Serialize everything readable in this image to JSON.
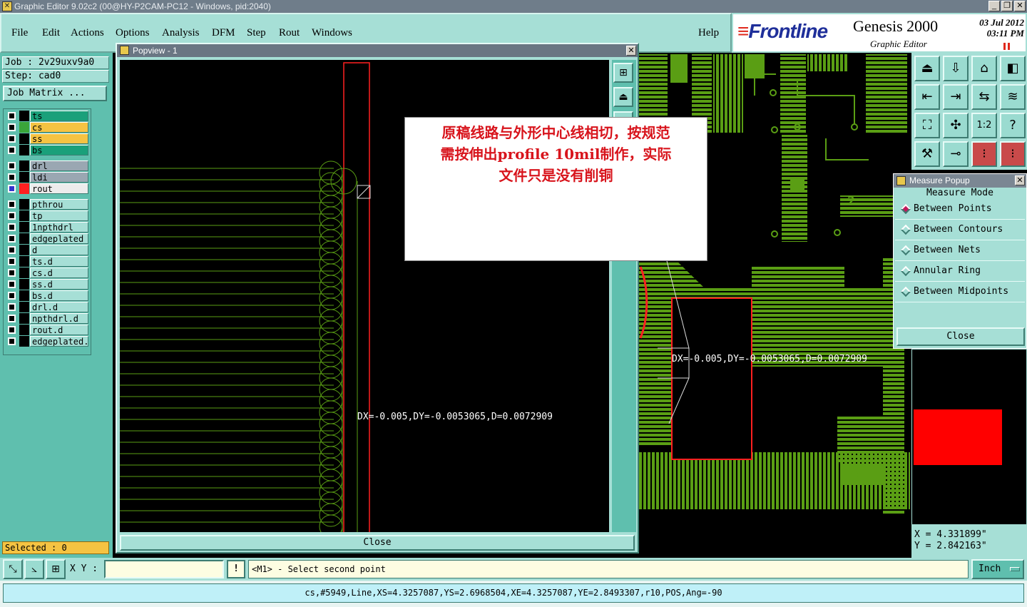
{
  "window": {
    "title": "Graphic Editor 9.02c2 (00@HY-P2CAM-PC12 - Windows, pid:2040)",
    "controls": [
      "_",
      "❐",
      "✕"
    ]
  },
  "menu": {
    "items": [
      "File",
      "Edit",
      "Actions",
      "Options",
      "Analysis",
      "DFM",
      "Step",
      "Rout",
      "Windows"
    ],
    "help": "Help"
  },
  "brand": {
    "logo_text": "Frontline",
    "product": "Genesis 2000",
    "subtitle": "Graphic Editor",
    "date": "03 Jul 2012",
    "time": "03:11 PM"
  },
  "job": {
    "job_label": "Job : 2v29uxv9a0",
    "step_label": "Step: cad0",
    "matrix_button": "Job Matrix ..."
  },
  "layers": [
    {
      "name": "ts",
      "color": "#1aa07a",
      "swatch": "#000000",
      "mark": ""
    },
    {
      "name": "cs",
      "color": "#f5c342",
      "swatch": "#3aa53a",
      "mark": "✍▣"
    },
    {
      "name": "ss",
      "color": "#f5c342",
      "swatch": "#000000",
      "mark": "✍"
    },
    {
      "name": "bs",
      "color": "#1aa07a",
      "swatch": "#000000",
      "mark": ""
    },
    {
      "name": "drl",
      "color": "#9aa7b2",
      "swatch": "#000000",
      "mark": ""
    },
    {
      "name": "ldi",
      "color": "#9aa7b2",
      "swatch": "#000000",
      "mark": ""
    },
    {
      "name": "rout",
      "color": "#ececec",
      "swatch": "#ff2020",
      "mark": "",
      "selected": true
    },
    {
      "name": "pthrou",
      "color": "#a6dfd6",
      "swatch": "#000000",
      "mark": ""
    },
    {
      "name": "tp",
      "color": "#a6dfd6",
      "swatch": "#000000",
      "mark": ""
    },
    {
      "name": "1npthdrl",
      "color": "#a6dfd6",
      "swatch": "#000000",
      "mark": ""
    },
    {
      "name": "edgeplated",
      "color": "#a6dfd6",
      "swatch": "#000000",
      "mark": ""
    },
    {
      "name": "d",
      "color": "#a6dfd6",
      "swatch": "#000000",
      "mark": ""
    },
    {
      "name": "ts.d",
      "color": "#a6dfd6",
      "swatch": "#000000",
      "mark": ""
    },
    {
      "name": "cs.d",
      "color": "#a6dfd6",
      "swatch": "#000000",
      "mark": ""
    },
    {
      "name": "ss.d",
      "color": "#a6dfd6",
      "swatch": "#000000",
      "mark": ""
    },
    {
      "name": "bs.d",
      "color": "#a6dfd6",
      "swatch": "#000000",
      "mark": ""
    },
    {
      "name": "drl.d",
      "color": "#a6dfd6",
      "swatch": "#000000",
      "mark": ""
    },
    {
      "name": "npthdrl.d",
      "color": "#a6dfd6",
      "swatch": "#000000",
      "mark": ""
    },
    {
      "name": "rout.d",
      "color": "#a6dfd6",
      "swatch": "#000000",
      "mark": ""
    },
    {
      "name": "edgeplated.",
      "color": "#a6dfd6",
      "swatch": "#000000",
      "mark": "●"
    }
  ],
  "selected_count": "Selected : 0",
  "popview": {
    "title": "Popview - 1",
    "measurement": "DX=-0.005,DY=-0.0053065,D=0.0072909",
    "close": "Close"
  },
  "note": {
    "lines": [
      "原稿线路与外形中心线相切，按规范",
      "需按伸出profile 10mil制作，实际",
      "文件只是没有削铜"
    ]
  },
  "main_measurement": "DX=-0.005,DY=-0.0053065,D=0.0072909",
  "main_label": "2",
  "measure_popup": {
    "title": "Measure Popup",
    "mode_label": "Measure Mode",
    "options": [
      {
        "label": "Between Points",
        "active": true
      },
      {
        "label": "Between Contours",
        "active": false
      },
      {
        "label": "Between Nets",
        "active": false
      },
      {
        "label": "Annular Ring",
        "active": false
      },
      {
        "label": "Between Midpoints",
        "active": false
      }
    ],
    "close": "Close"
  },
  "right_tools": {
    "icons": [
      "zoom-home-icon",
      "zoom-down-icon",
      "home-icon",
      "split-view-icon",
      "pan-left-icon",
      "pan-right-icon",
      "mirror-icon",
      "snake-icon",
      "fit-icon",
      "center-icon",
      "ratio-icon",
      "help-icon",
      "measure-tool-icon",
      "probe-icon",
      "net-icon",
      "net-select-icon"
    ],
    "ratio_text": "1:2",
    "help_text": "?"
  },
  "coordinates": {
    "x": "X = 4.331899\"",
    "y": "Y = 2.842163\""
  },
  "command": {
    "xy_label": "X Y :",
    "xy_value": "",
    "bang": "!",
    "prompt": "<M1> - Select second point",
    "unit": "Inch"
  },
  "status": "cs,#5949,Line,XS=4.3257087,YS=2.6968504,XE=4.3257087,YE=2.8493307,r10,POS,Ang=-90",
  "colors": {
    "panel": "#a6dfd6",
    "panel_dark": "#5fbfae",
    "copper": "#5a9e14",
    "rout": "#ff2020",
    "note_text": "#d8141c"
  }
}
